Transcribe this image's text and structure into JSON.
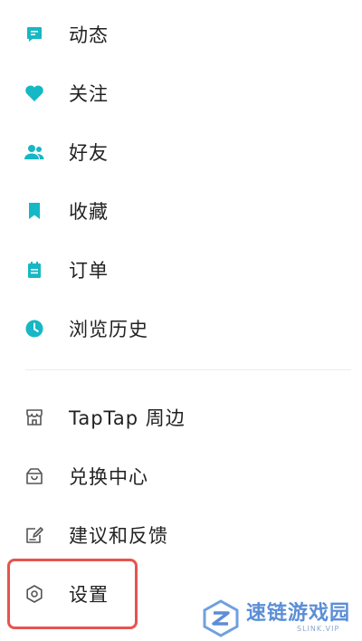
{
  "menu": {
    "items": [
      {
        "label": "动态",
        "icon": "message-square-icon"
      },
      {
        "label": "关注",
        "icon": "heart-icon"
      },
      {
        "label": "好友",
        "icon": "friends-icon"
      },
      {
        "label": "收藏",
        "icon": "bookmark-icon"
      },
      {
        "label": "订单",
        "icon": "order-icon"
      },
      {
        "label": "浏览历史",
        "icon": "clock-icon"
      }
    ],
    "secondary_items": [
      {
        "label": "TapTap 周边",
        "icon": "shop-icon"
      },
      {
        "label": "兑换中心",
        "icon": "gift-bag-icon"
      },
      {
        "label": "建议和反馈",
        "icon": "feedback-edit-icon"
      },
      {
        "label": "设置",
        "icon": "settings-icon"
      }
    ]
  },
  "colors": {
    "accent": "#15b8c4",
    "outline_icon": "#555555",
    "highlight_border": "#e8534f",
    "watermark": "#5b8ed6"
  },
  "watermark": {
    "title": "速链游戏园",
    "subtitle": "SLINK.VIP"
  }
}
